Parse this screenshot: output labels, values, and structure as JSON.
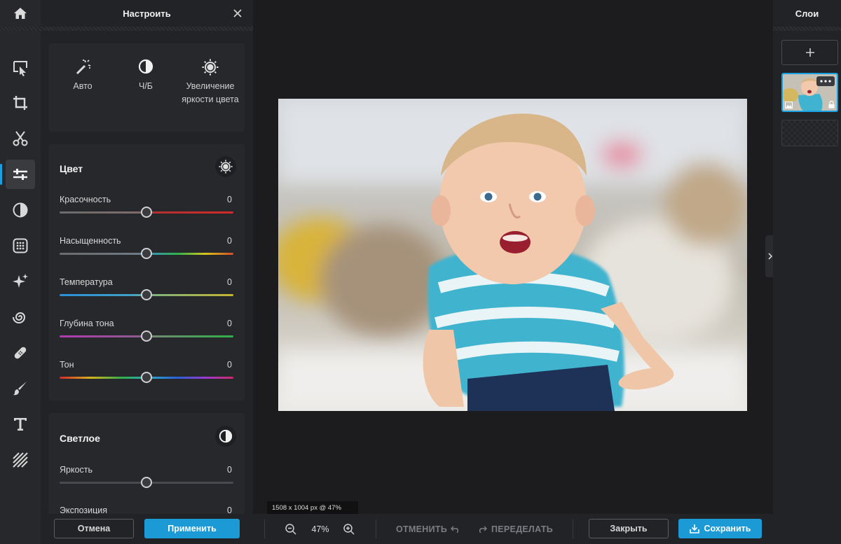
{
  "panel": {
    "title": "Настроить",
    "presets": [
      {
        "label": "Авто",
        "icon": "magic-wand-icon"
      },
      {
        "label": "Ч/Б",
        "icon": "half-circle-icon"
      },
      {
        "label": "Увеличение яркости цвета",
        "icon": "sun-icon"
      }
    ],
    "color_section": {
      "title": "Цвет",
      "sliders": [
        {
          "label": "Красочность",
          "value": "0"
        },
        {
          "label": "Насыщенность",
          "value": "0"
        },
        {
          "label": "Температура",
          "value": "0"
        },
        {
          "label": "Глубина тона",
          "value": "0"
        },
        {
          "label": "Тон",
          "value": "0"
        }
      ]
    },
    "light_section": {
      "title": "Светлое",
      "sliders": [
        {
          "label": "Яркость",
          "value": "0"
        },
        {
          "label": "Экспозиция",
          "value": "0"
        }
      ]
    },
    "cancel_label": "Отмена",
    "apply_label": "Применить"
  },
  "canvas": {
    "dimensions_label": "1508 x 1004 px @ 47%",
    "zoom": "47%"
  },
  "toolbar": {
    "undo_label": "ОТМЕНИТЬ",
    "redo_label": "ПЕРЕДЕЛАТЬ",
    "close_label": "Закрыть",
    "save_label": "Сохранить"
  },
  "layers": {
    "title": "Слои"
  },
  "colors": {
    "accent": "#1b9ad6",
    "panel_bg": "#222326",
    "canvas_bg": "#1c1c1e"
  }
}
